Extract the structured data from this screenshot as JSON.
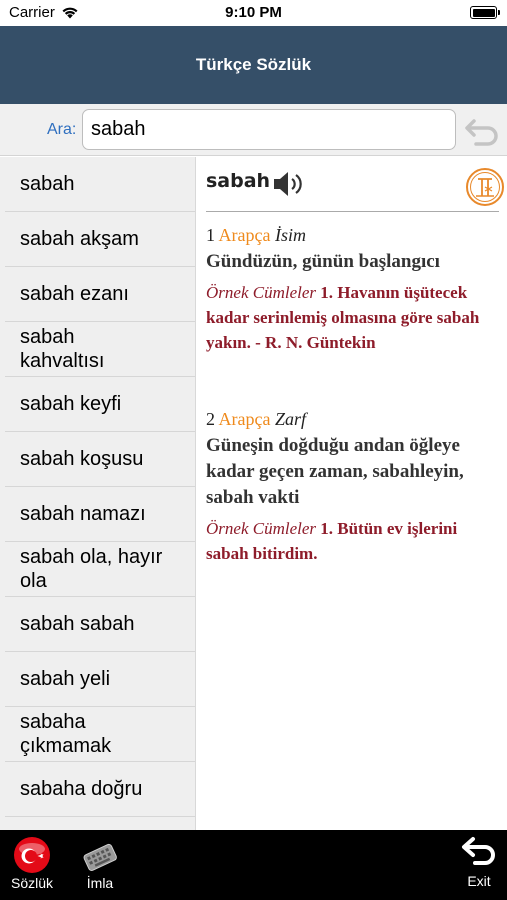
{
  "status": {
    "carrier": "Carrier",
    "time": "9:10 PM"
  },
  "nav": {
    "title": "Türkçe Sözlük"
  },
  "search": {
    "label": "Ara:",
    "value": "sabah"
  },
  "words": [
    "sabah",
    "sabah akşam",
    "sabah ezanı",
    "sabah kahvaltısı",
    "sabah keyfi",
    "sabah koşusu",
    "sabah namazı",
    "sabah ola, hayır ola",
    "sabah sabah",
    "sabah yeli",
    "sabaha çıkmamak",
    "sabaha doğru"
  ],
  "entry": {
    "word": "sabah",
    "senses": [
      {
        "num": "1",
        "origin": "Arapça",
        "pos": "İsim",
        "meaning": "Gündüzün, günün başlangıcı",
        "example_label": "Örnek Cümleler",
        "example": "1. Havanın üşütecek kadar serinlemiş olmasına göre sabah yakın. - R. N. Güntekin"
      },
      {
        "num": "2",
        "origin": "Arapça",
        "pos": "Zarf",
        "meaning": "Güneşin doğduğu andan öğleye kadar geçen zaman, sabahleyin, sabah vakti",
        "example_label": "Örnek Cümleler",
        "example": "1. Bütün ev işlerini sabah bitirdim."
      }
    ]
  },
  "tabs": {
    "sozluk": "Sözlük",
    "imla": "İmla",
    "exit": "Exit"
  },
  "colors": {
    "nav": "#354f68",
    "origin": "#ef8a1c",
    "example": "#8e1c2a",
    "link": "#2f6fbf"
  }
}
